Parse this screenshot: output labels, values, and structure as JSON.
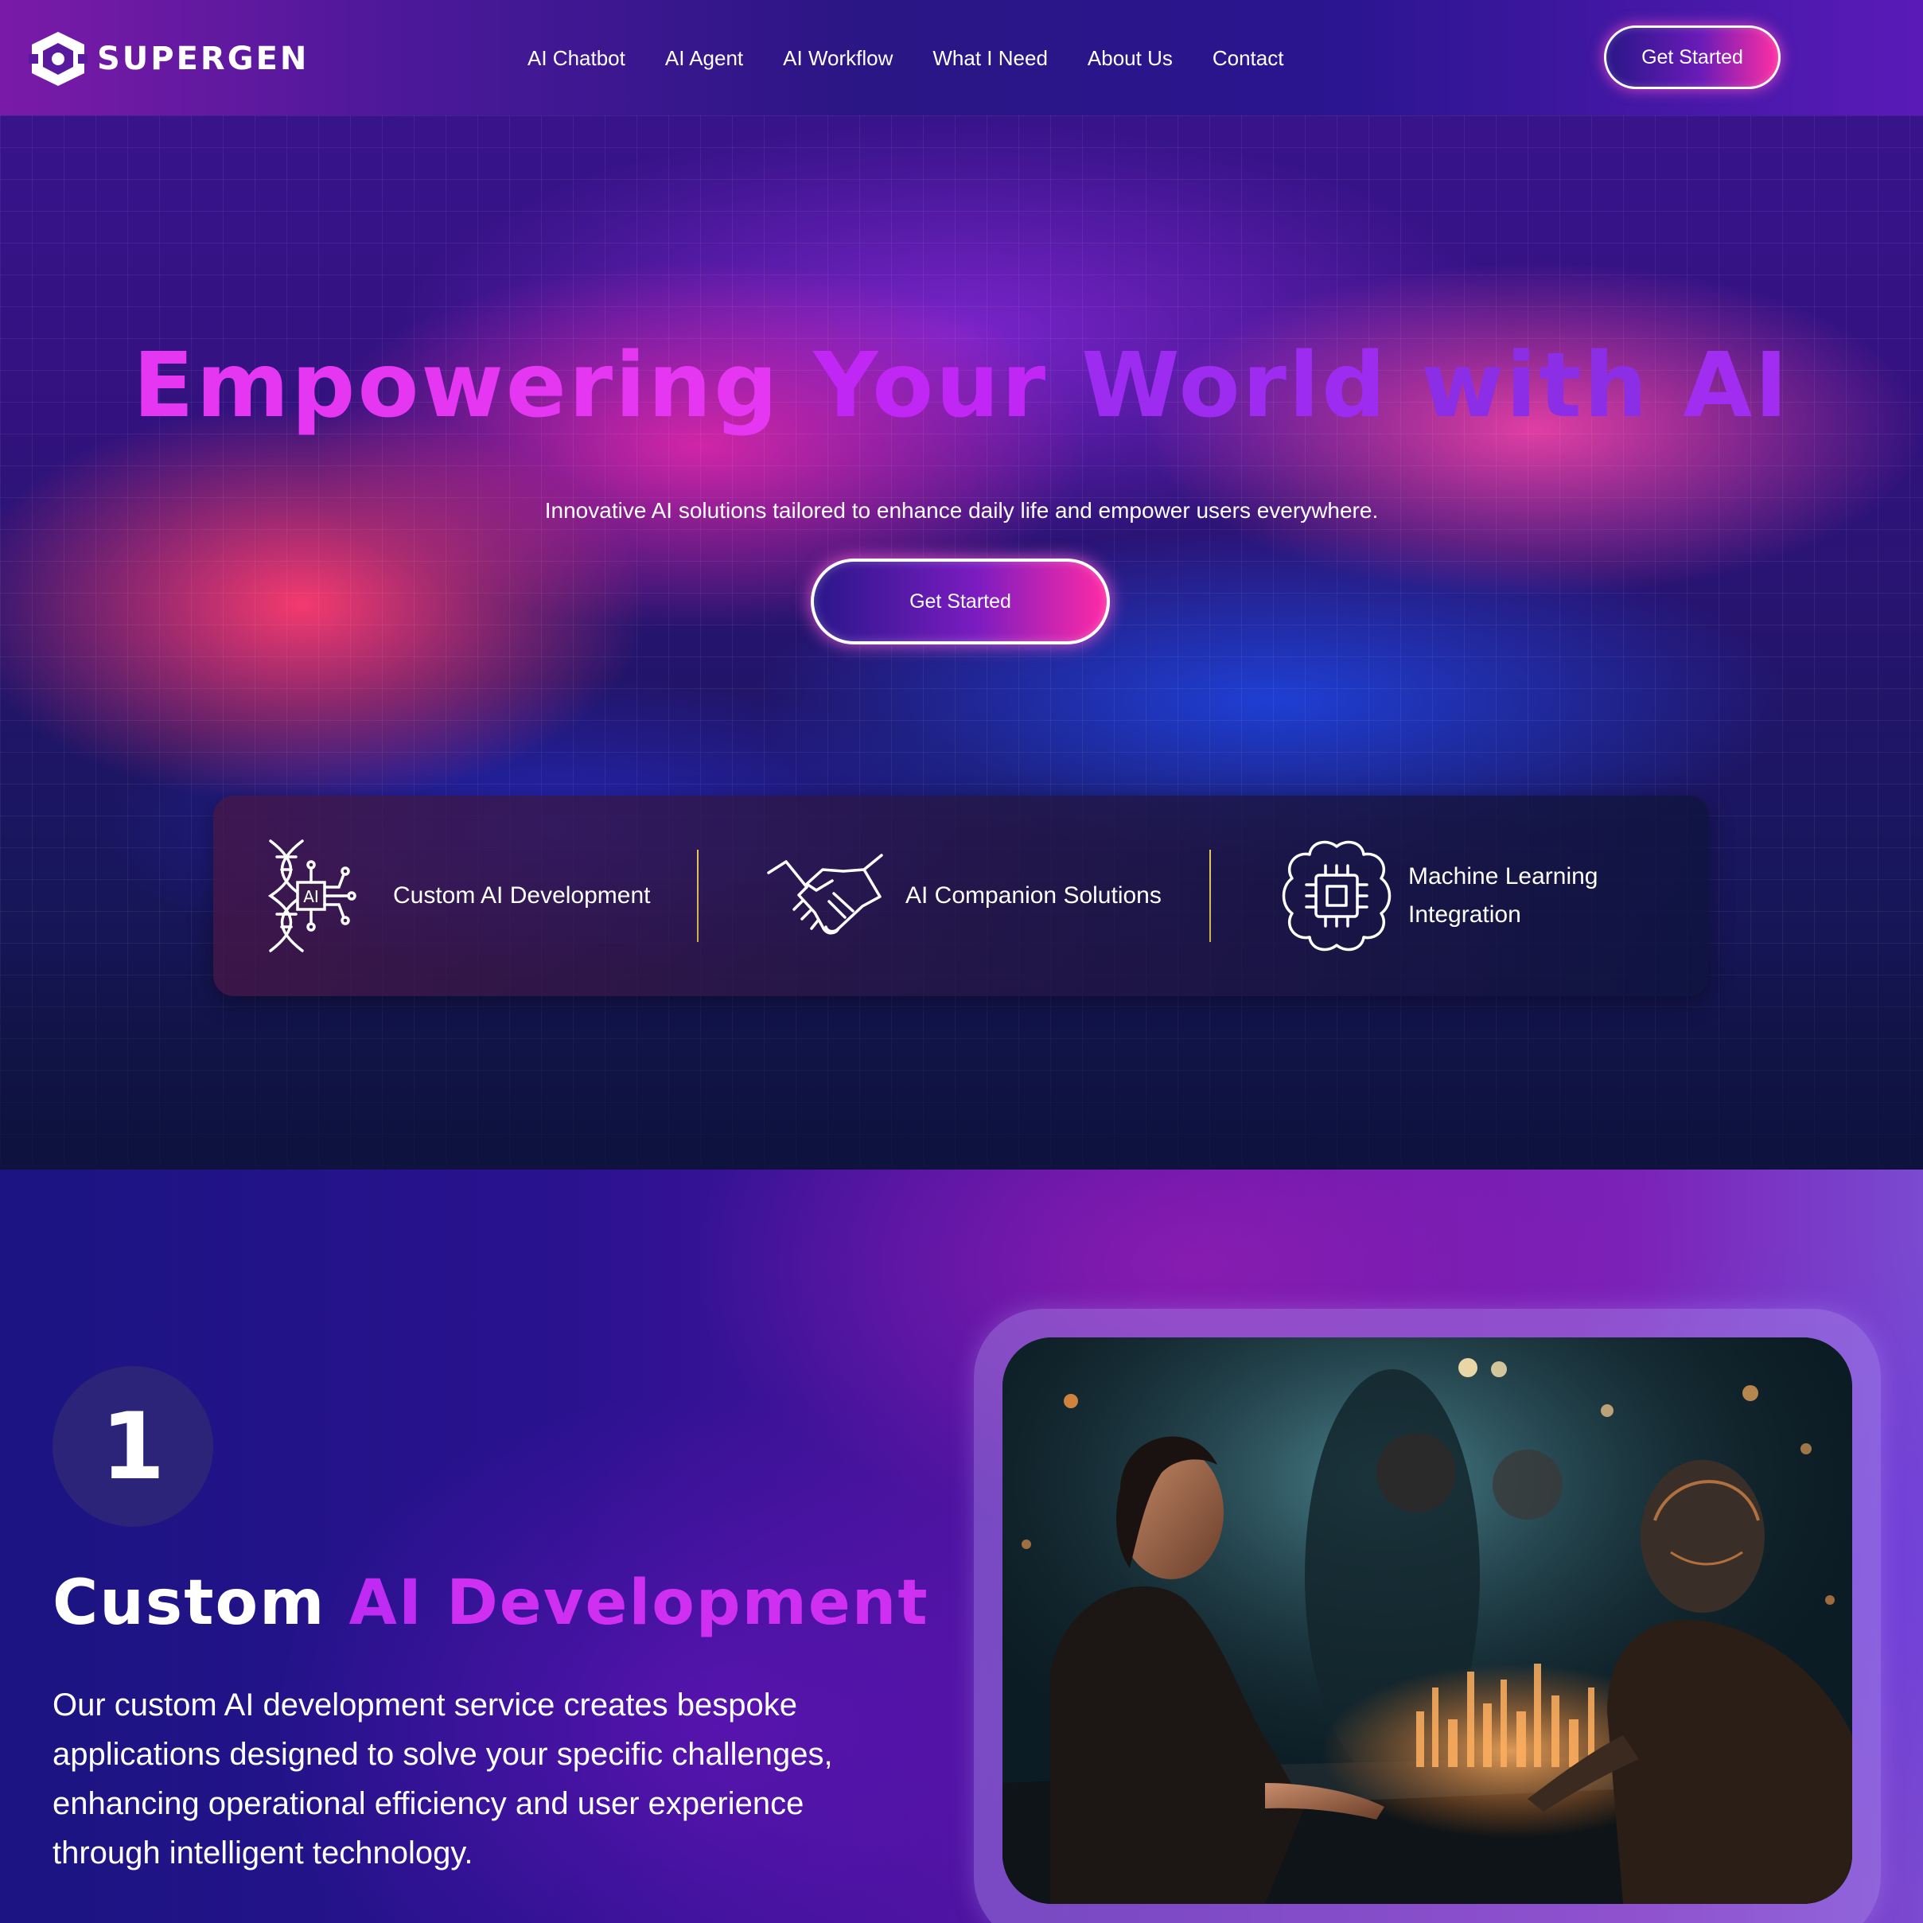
{
  "brand": {
    "name": "SUPERGEN"
  },
  "nav": {
    "items": [
      {
        "label": "AI Chatbot"
      },
      {
        "label": "AI Agent"
      },
      {
        "label": "AI Workflow"
      },
      {
        "label": "What I Need"
      },
      {
        "label": "About Us"
      },
      {
        "label": "Contact"
      }
    ],
    "cta_label": "Get Started"
  },
  "hero": {
    "title_words": [
      "Empowering",
      "Your",
      "World",
      "with",
      "AI"
    ],
    "subtitle": "Innovative AI solutions tailored to enhance daily life and empower users everywhere.",
    "cta_label": "Get Started"
  },
  "features": [
    {
      "label": "Custom AI Development",
      "icon": "dna-ai-icon",
      "icon_text": "AI"
    },
    {
      "label": "AI Companion Solutions",
      "icon": "handshake-icon"
    },
    {
      "label_lines": [
        "Machine Learning",
        "Integration"
      ],
      "icon": "brain-chip-icon"
    }
  ],
  "section": {
    "step_number": "1",
    "title_words": [
      "Custom",
      "AI",
      "Development"
    ],
    "description": "Our custom AI development service creates bespoke applications designed to solve your specific challenges, enhancing operational efficiency and user experience through intelligent technology."
  },
  "colors": {
    "accent_magenta": "#e536f2",
    "accent_violet": "#9d2cf0",
    "cta_pink": "#ff2aa6",
    "divider_gold": "#e8c95a",
    "nav_bg": "#2a1684"
  }
}
